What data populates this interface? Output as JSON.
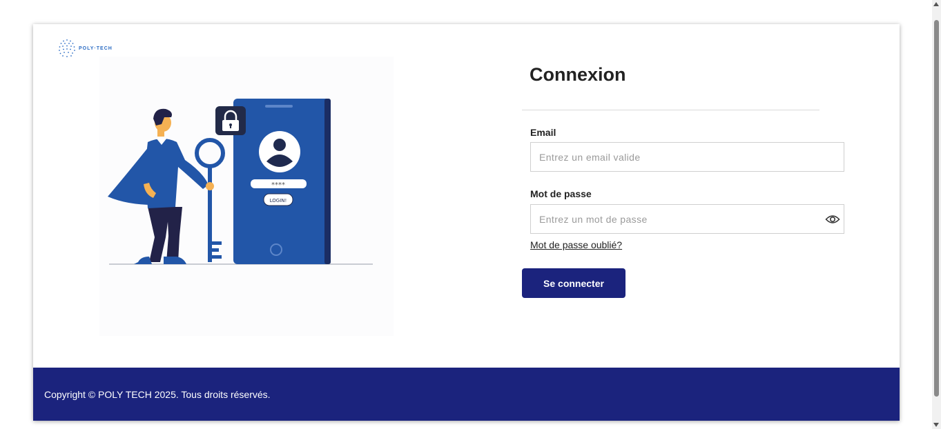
{
  "brand": {
    "logo_text": "POLY·TECH"
  },
  "illustration": {
    "pin_mask": "****",
    "login_label": "LOGIN!"
  },
  "login": {
    "title": "Connexion",
    "email_label": "Email",
    "email_placeholder": "Entrez un email valide",
    "password_label": "Mot de passe",
    "password_placeholder": "Entrez un mot de passe",
    "forgot_label": "Mot de passe oublié?",
    "submit_label": "Se connecter"
  },
  "footer": {
    "copyright": "Copyright © POLY TECH 2025. Tous droits réservés."
  },
  "colors": {
    "primary": "#1b237d",
    "illustration_blue": "#2256a8",
    "accent_skin": "#f5b153"
  },
  "icons": {
    "logo": "dotted-globe-icon",
    "password_toggle": "eye-icon",
    "lock": "lock-icon"
  }
}
